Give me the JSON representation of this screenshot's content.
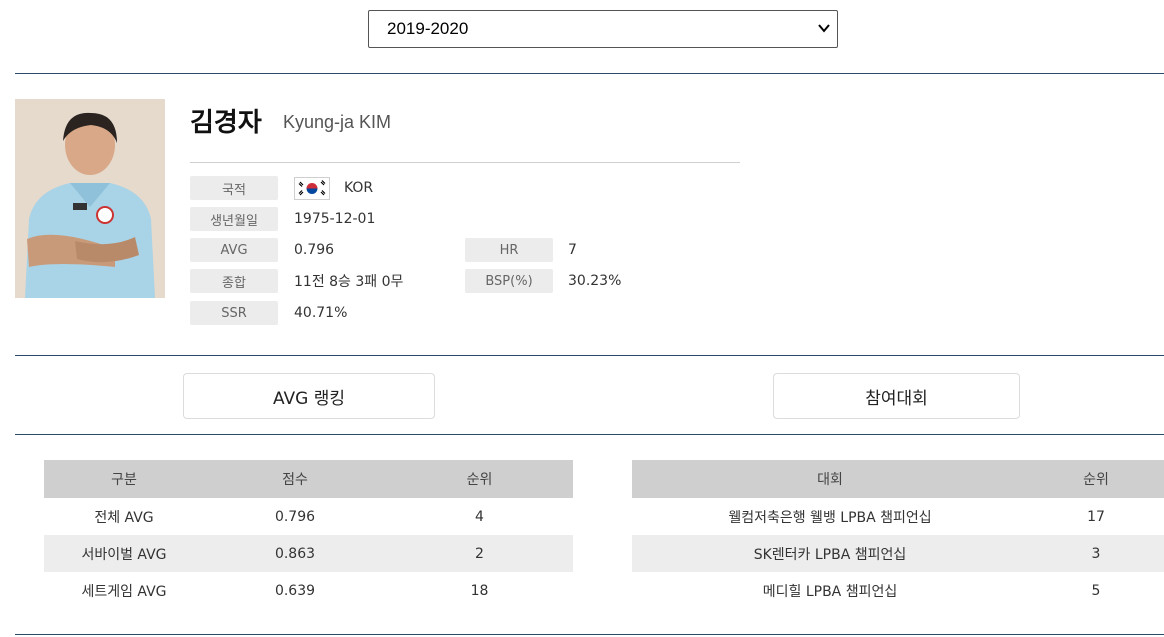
{
  "season_select": {
    "value": "2019-2020"
  },
  "profile": {
    "name_ko": "김경자",
    "name_en": "Kyung-ja KIM",
    "fields": {
      "nationality_label": "국적",
      "nationality_value": "KOR",
      "birth_label": "생년월일",
      "birth_value": "1975-12-01",
      "avg_label": "AVG",
      "avg_value": "0.796",
      "hr_label": "HR",
      "hr_value": "7",
      "record_label": "종합",
      "record_value": "11전 8승 3패 0무",
      "bsp_label": "BSP(%)",
      "bsp_value": "30.23%",
      "ssr_label": "SSR",
      "ssr_value": "40.71%"
    }
  },
  "tabs": {
    "avg_ranking": "AVG 랭킹",
    "tournaments": "참여대회"
  },
  "avg_table": {
    "headers": [
      "구분",
      "점수",
      "순위"
    ],
    "rows": [
      [
        "전체 AVG",
        "0.796",
        "4"
      ],
      [
        "서바이벌 AVG",
        "0.863",
        "2"
      ],
      [
        "세트게임 AVG",
        "0.639",
        "18"
      ]
    ]
  },
  "tournament_table": {
    "headers": [
      "대회",
      "순위"
    ],
    "rows": [
      [
        "웰컴저축은행 웰뱅 LPBA 챔피언십",
        "17"
      ],
      [
        "SK렌터카 LPBA 챔피언십",
        "3"
      ],
      [
        "메디힐 LPBA 챔피언십",
        "5"
      ]
    ]
  },
  "colors": {
    "divider": "#2b4a6b",
    "table_header": "#cfcfcf",
    "row_alt": "#ededed",
    "label_bg": "#ececec"
  },
  "icons": {
    "select": "chevron-down-icon",
    "flag": "korea-flag-icon"
  }
}
